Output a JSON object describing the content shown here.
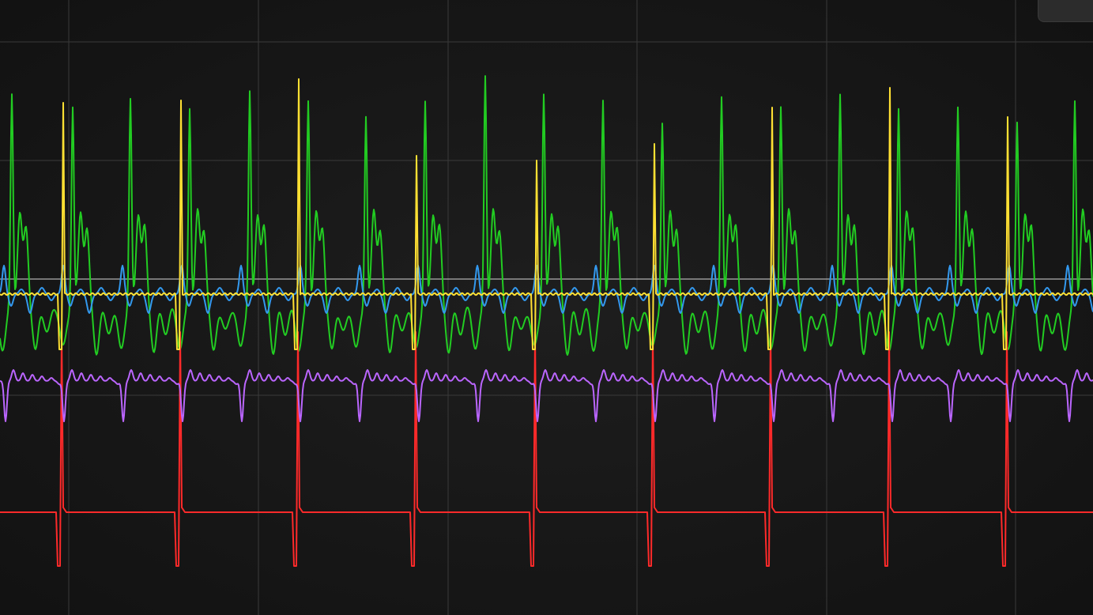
{
  "chart_data": {
    "type": "line",
    "title": "",
    "xlabel": "",
    "ylabel": "",
    "grid": true,
    "legend": "none",
    "x_range": [
      0,
      1383
    ],
    "grid_x": [
      87,
      327,
      567,
      806,
      1046,
      1285
    ],
    "grid_y": [
      53,
      203,
      353,
      500
    ],
    "series": [
      {
        "key": "red",
        "color": "#ff2a2a",
        "baseline": 648,
        "spike_top": 420,
        "trough": 716,
        "beats_x": [
          78,
          228,
          377,
          526,
          677,
          826,
          975,
          1125,
          1274
        ]
      },
      {
        "key": "yellow",
        "color": "#ffe033",
        "baseline": 372,
        "trough": 442,
        "beats_x": [
          80,
          229,
          378,
          527,
          679,
          828,
          977,
          1126,
          1275
        ],
        "peaks": [
          130,
          127,
          100,
          197,
          203,
          182,
          136,
          111,
          148
        ]
      },
      {
        "key": "green",
        "color": "#22cc22",
        "beats_x": [
          15,
          92,
          165,
          240,
          316,
          390,
          463,
          538,
          614,
          688,
          763,
          838,
          913,
          988,
          1063,
          1137,
          1212,
          1287,
          1360
        ],
        "peaks": [
          121,
          133,
          128,
          134,
          117,
          128,
          143,
          131,
          92,
          119,
          128,
          152,
          126,
          131,
          121,
          138,
          132,
          158,
          125
        ],
        "low": 445
      },
      {
        "key": "blue",
        "color": "#3399ee",
        "baseline": 372,
        "beats_x": [
          5,
          80,
          155,
          230,
          305,
          380,
          455,
          529,
          604,
          679,
          754,
          828,
          903,
          978,
          1053,
          1128,
          1202,
          1277,
          1351
        ],
        "peak": 336,
        "trough": 396
      },
      {
        "key": "purple",
        "color": "#bb66ff",
        "baseline": 482,
        "beats_x": [
          7,
          81,
          156,
          231,
          306,
          380,
          455,
          530,
          605,
          680,
          754,
          829,
          904,
          979,
          1054,
          1129,
          1203,
          1278,
          1353
        ],
        "trough": 533
      }
    ],
    "reference_line": {
      "y": 353,
      "color": "#b0b0b0"
    }
  }
}
